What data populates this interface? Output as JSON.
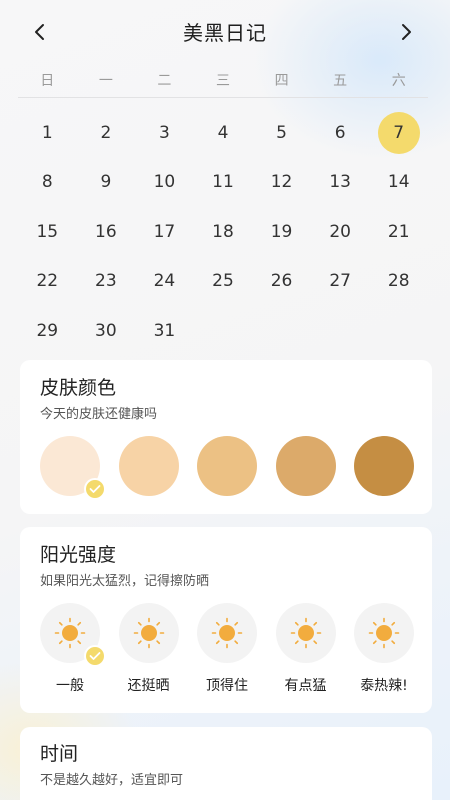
{
  "header": {
    "title": "美黑日记",
    "prev_icon": "chevron-left-icon",
    "next_icon": "chevron-right-icon"
  },
  "calendar": {
    "weekdays": [
      "日",
      "一",
      "二",
      "三",
      "四",
      "五",
      "六"
    ],
    "leading_blanks": 0,
    "days": [
      "1",
      "2",
      "3",
      "4",
      "5",
      "6",
      "7",
      "8",
      "9",
      "10",
      "11",
      "12",
      "13",
      "14",
      "15",
      "16",
      "17",
      "18",
      "19",
      "20",
      "21",
      "22",
      "23",
      "24",
      "25",
      "26",
      "27",
      "28",
      "29",
      "30",
      "31"
    ],
    "selected_day": "7",
    "selected_color": "#f4da6c"
  },
  "skin": {
    "title": "皮肤颜色",
    "subtitle": "今天的皮肤还健康吗",
    "colors": [
      "#fbe8d5",
      "#f7d3a6",
      "#ecc184",
      "#dcaa6a",
      "#c58e43"
    ],
    "selected_index": 0
  },
  "sun": {
    "title": "阳光强度",
    "subtitle": "如果阳光太猛烈，记得擦防晒",
    "levels": [
      "一般",
      "还挺晒",
      "顶得住",
      "有点猛",
      "泰热辣!"
    ],
    "selected_index": 0,
    "icon": "sun-icon",
    "sun_color": "#f2ac3e"
  },
  "time": {
    "title": "时间",
    "subtitle": "不是越久越好，适宜即可"
  }
}
